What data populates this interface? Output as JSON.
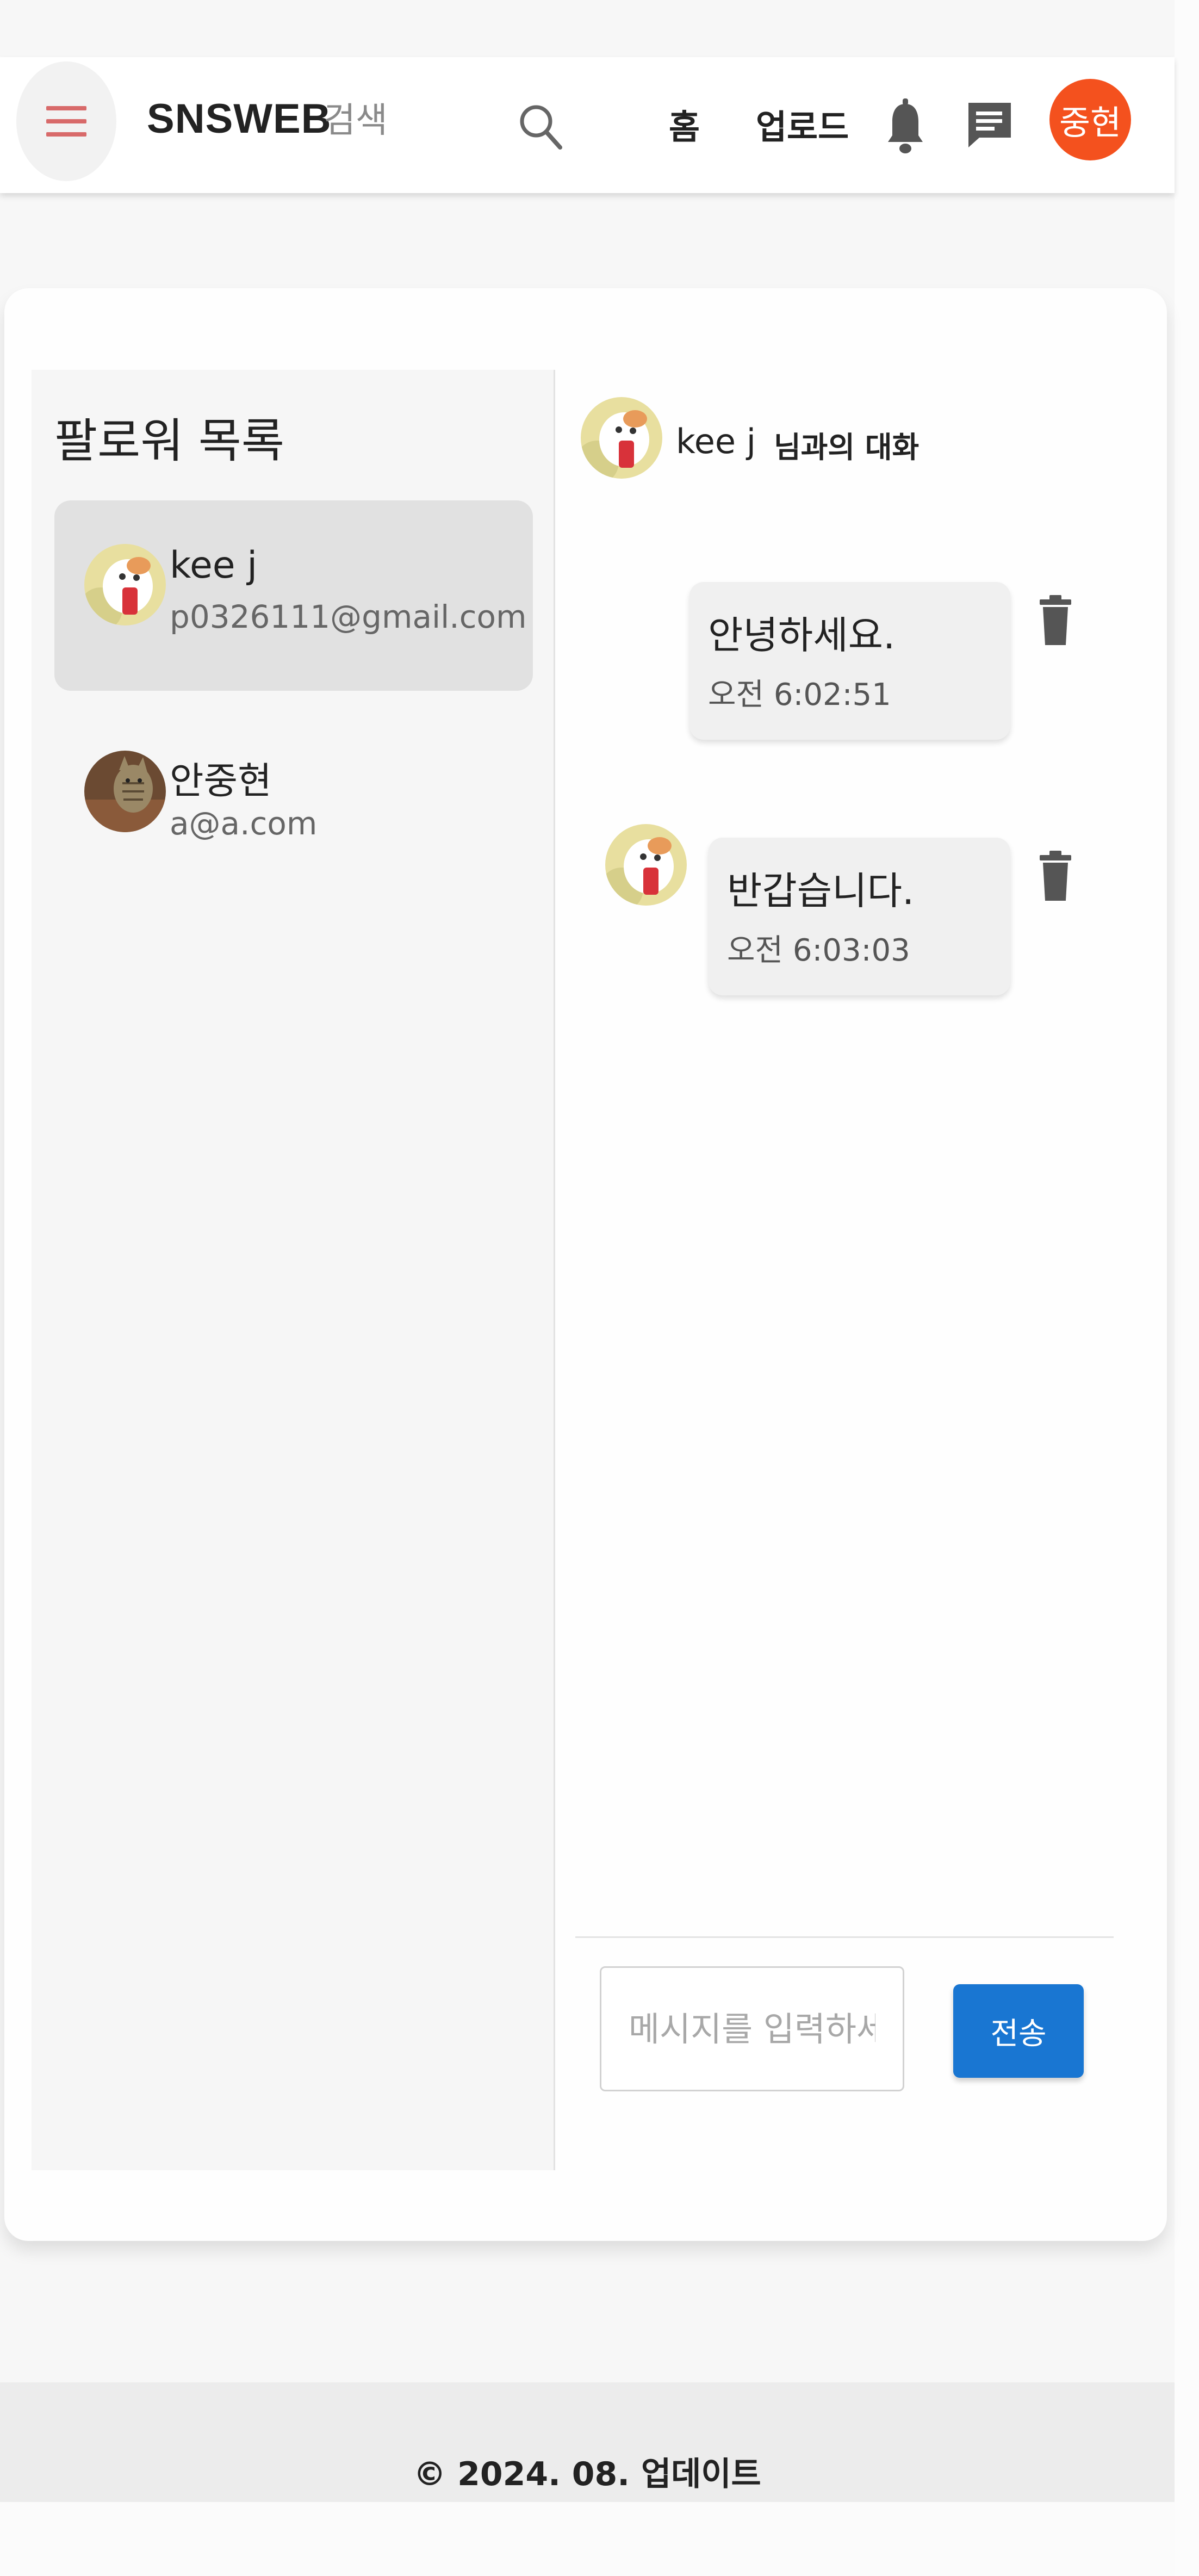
{
  "header": {
    "brand": "SNSWEB",
    "search_placeholder": "검색",
    "nav": {
      "home": "홈",
      "upload": "업로드"
    },
    "user_avatar_text": "중현",
    "colors": {
      "menu_icon": "#d86a6a",
      "avatar": "#f4511e"
    },
    "icons": [
      "menu-icon",
      "search-icon",
      "bell-icon",
      "chat-icon"
    ]
  },
  "sidebar": {
    "title": "팔로워 목록",
    "followers": [
      {
        "name": "kee j",
        "email": "p0326111@gmail.com",
        "selected": true,
        "avatar": "hamster-avatar"
      },
      {
        "name": "안중현",
        "email": "a@a.com",
        "selected": false,
        "avatar": "cat-avatar"
      }
    ]
  },
  "chat": {
    "partner_name": "kee j",
    "title_suffix": "님과의 대화",
    "messages": [
      {
        "text": "안녕하세요.",
        "time": "오전 6:02:51",
        "side": "right"
      },
      {
        "text": "반갑습니다.",
        "time": "오전 6:03:03",
        "side": "left"
      }
    ],
    "input_placeholder": "메시지를 입력하세요",
    "send_label": "전송",
    "send_color": "#1976d2"
  },
  "footer": {
    "text": "© 2024. 08. 업데이트"
  }
}
